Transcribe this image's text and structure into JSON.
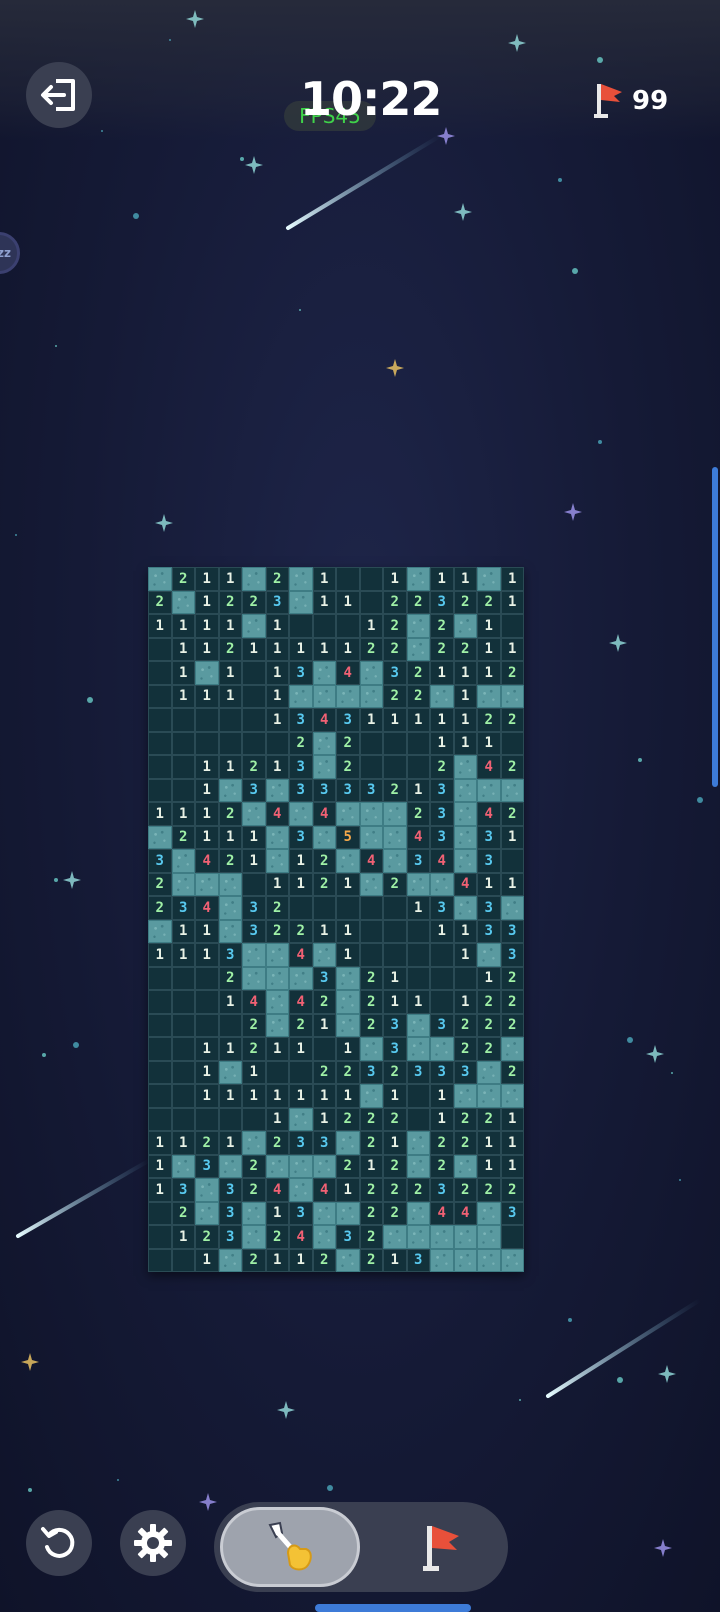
{
  "header": {
    "timer": "10:22",
    "fps": "FPS45",
    "flag_count": "99",
    "side_badge": "zz"
  },
  "icons": {
    "exit": "exit-icon",
    "flag": "flag-icon",
    "restart": "restart-icon",
    "settings": "gear-icon",
    "dig": "shovel-icon",
    "flag_mode": "flag-icon"
  },
  "colors": {
    "num1": "#e9f2e6",
    "num2": "#9ff0a6",
    "num3": "#58c9ef",
    "num4": "#f16174",
    "num5": "#f5a84a",
    "covered": "#5a9aa0",
    "revealed": "#12313a",
    "flag": "#e8503a"
  },
  "board": {
    "cols": 16,
    "rows": [
      "#211#2#1..1#11#1",
      "2#1223#11.223221",
      "1111#1...12#2#1.",
      ".1121111122#2211",
      ".1#1.13#4#3211122",
      ".111.1####22#1##",
      ".....134311111222",
      "......2#2...111.",
      "..1121 3#2...2#42",
      "..1#3#3333213###",
      "1112#4#4###23#42",
      "#2111#3#5##43#31.",
      "3#421#12#4#34#3..",
      "2###.1121#2##411",
      "234#32.....13#3#2",
      "#11#32211...1133#",
      "1113##4#1....1#3",
      "...2###3#21...12#",
      "...14#42#211.122",
      "....2#21#23#3222#2",
      "..1121 1.1#3##22#",
      "..1#1..2232333#2",
      "..1111111#1.1###1",
      ".....1#1222.1221",
      "1121#233#21#221111",
      "1#3#2###212#2#11#",
      "13#324#412223222 21",
      ".2#3#13##22#44#31",
      ".123#24#32#####",
      "..1#2112#213#####"
    ]
  }
}
